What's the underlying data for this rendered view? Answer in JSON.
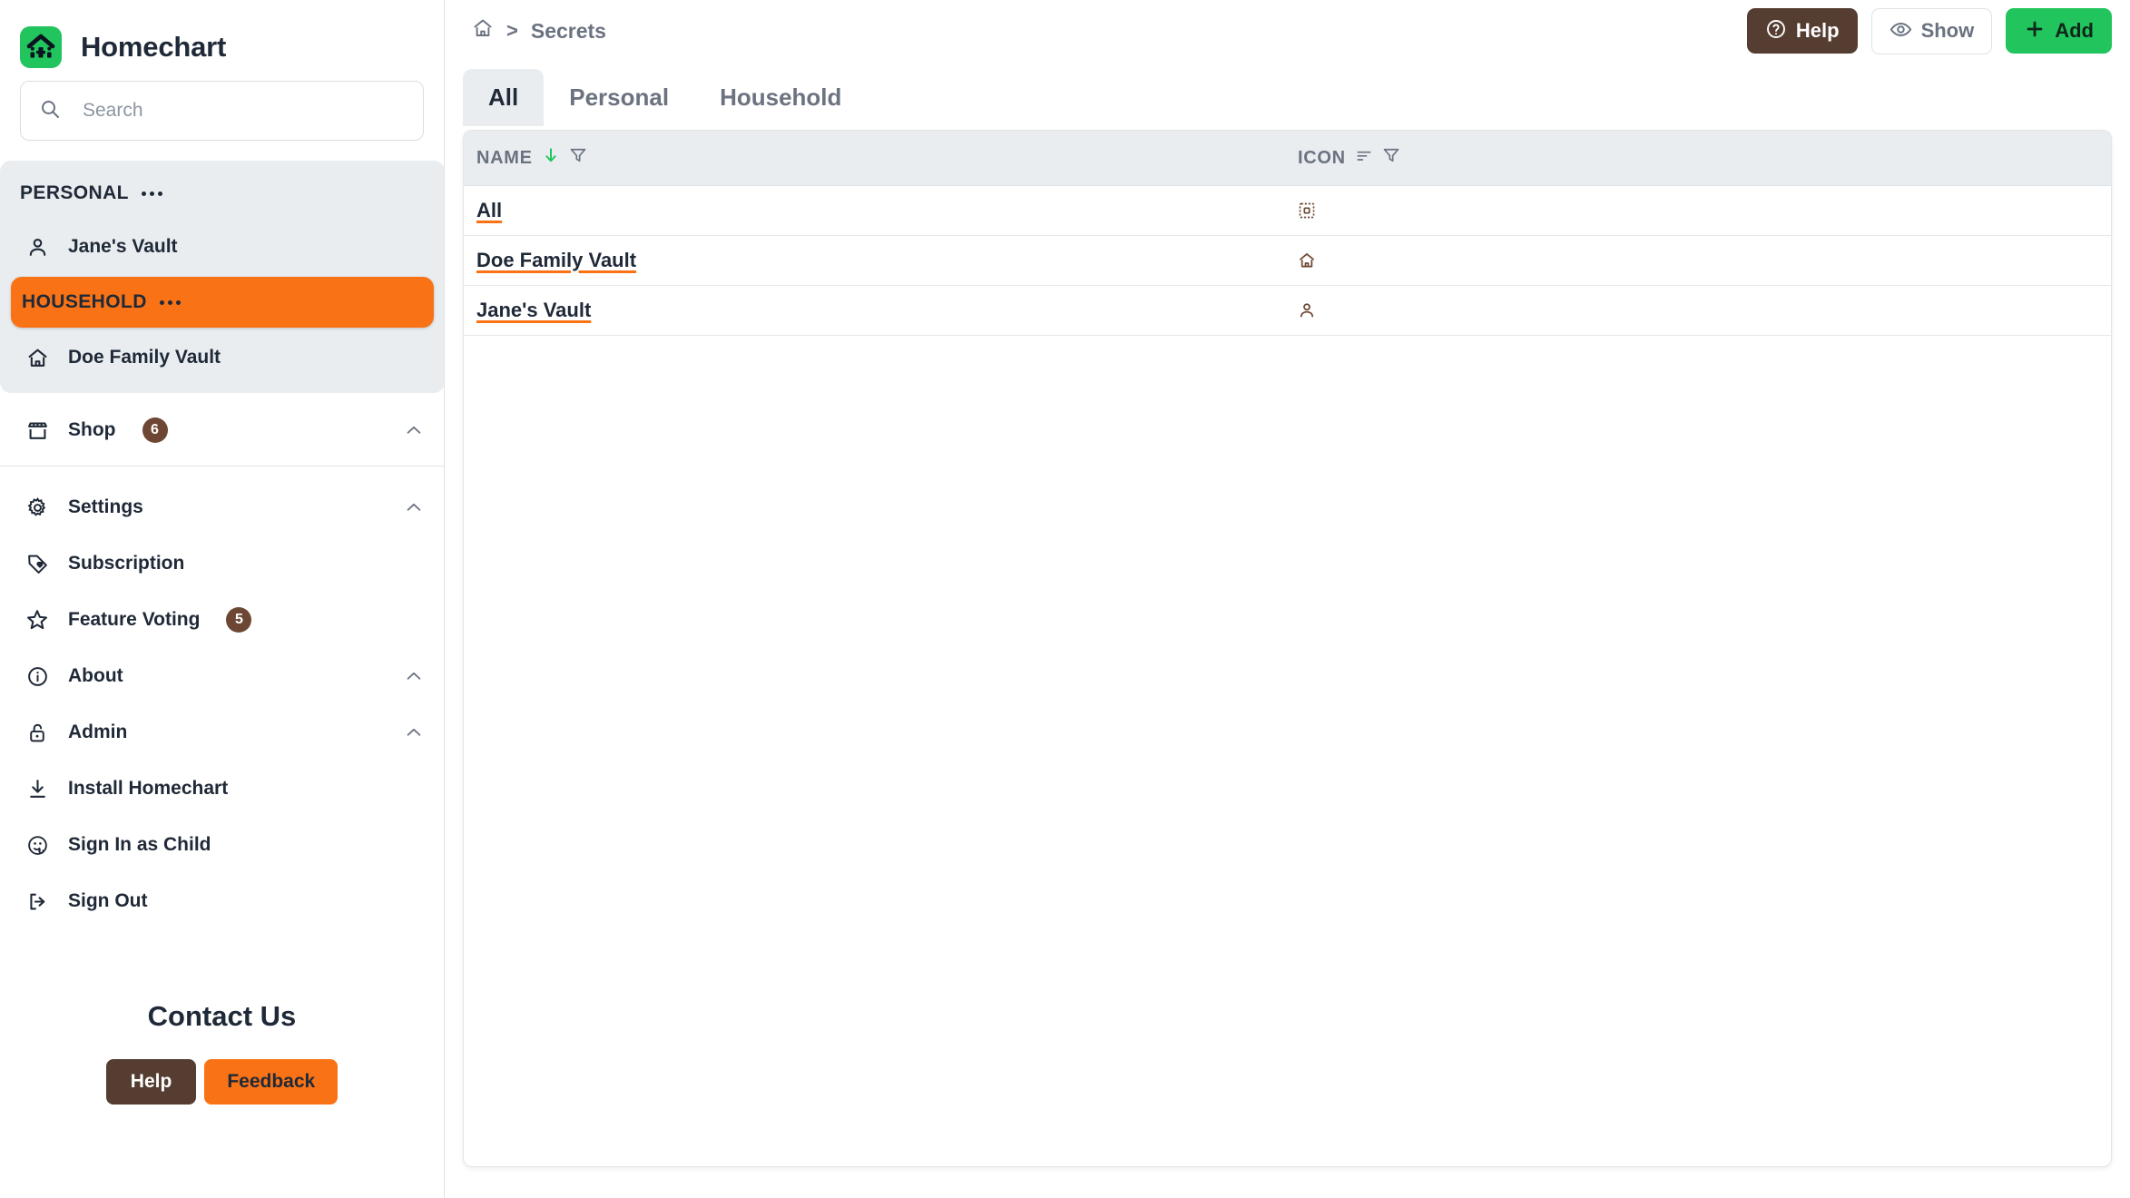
{
  "app": {
    "brand": "Homechart",
    "logo_color": "#21c45d",
    "accent_orange": "#f97316",
    "accent_brown": "#6d4733"
  },
  "search": {
    "placeholder": "Search",
    "value": "",
    "icon": "search-icon"
  },
  "sidebar": {
    "personal": {
      "label": "PERSONAL",
      "menu_icon": "ellipsis-icon",
      "active": false,
      "items": [
        {
          "label": "Jane's Vault",
          "icon": "person-icon"
        }
      ]
    },
    "household": {
      "label": "HOUSEHOLD",
      "menu_icon": "ellipsis-icon",
      "active": true,
      "items": [
        {
          "label": "Doe Family Vault",
          "icon": "house-icon"
        }
      ]
    },
    "shop": {
      "label": "Shop",
      "icon": "store-icon",
      "badge": "6",
      "chevron": "chevron-up-icon"
    },
    "menu": [
      {
        "label": "Settings",
        "icon": "gear-icon",
        "chevron": "chevron-up-icon",
        "badge": ""
      },
      {
        "label": "Subscription",
        "icon": "tag-heart-icon",
        "chevron": "",
        "badge": ""
      },
      {
        "label": "Feature Voting",
        "icon": "star-icon",
        "chevron": "",
        "badge": "5"
      },
      {
        "label": "About",
        "icon": "info-circle-icon",
        "chevron": "chevron-up-icon",
        "badge": ""
      },
      {
        "label": "Admin",
        "icon": "unlock-icon",
        "chevron": "chevron-up-icon",
        "badge": ""
      },
      {
        "label": "Install Homechart",
        "icon": "download-icon",
        "chevron": "",
        "badge": ""
      },
      {
        "label": "Sign In as Child",
        "icon": "child-face-icon",
        "chevron": "",
        "badge": ""
      },
      {
        "label": "Sign Out",
        "icon": "logout-icon",
        "chevron": "",
        "badge": ""
      }
    ],
    "contact": {
      "title": "Contact Us",
      "help_label": "Help",
      "feedback_label": "Feedback"
    }
  },
  "header": {
    "breadcrumb": {
      "home_icon": "house-icon",
      "separator": ">",
      "current": "Secrets"
    },
    "actions": [
      {
        "label": "Help",
        "icon": "question-circle-icon",
        "style": "brown"
      },
      {
        "label": "Show",
        "icon": "eye-icon",
        "style": "outline"
      },
      {
        "label": "Add",
        "icon": "plus-icon",
        "style": "green"
      }
    ]
  },
  "tabs": [
    {
      "label": "All",
      "active": true
    },
    {
      "label": "Personal",
      "active": false
    },
    {
      "label": "Household",
      "active": false
    }
  ],
  "table": {
    "columns": [
      {
        "label": "NAME",
        "sort": "desc",
        "sort_icon": "arrow-down-icon",
        "filter_icon": "funnel-icon"
      },
      {
        "label": "ICON",
        "sort": "none",
        "sort_icon": "sort-lines-icon",
        "filter_icon": "funnel-icon"
      }
    ],
    "rows": [
      {
        "name": "All",
        "icon": "dashed-square-icon"
      },
      {
        "name": "Doe Family Vault",
        "icon": "house-icon"
      },
      {
        "name": "Jane's Vault",
        "icon": "person-icon"
      }
    ]
  }
}
